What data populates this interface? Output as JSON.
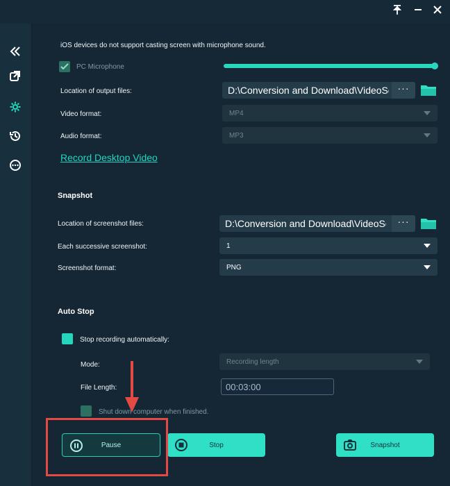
{
  "sidebar": {
    "icons": [
      "collapse-icon",
      "screen-mirror-icon",
      "settings-icon",
      "history-icon",
      "more-icon"
    ]
  },
  "recording": {
    "ios_note": "iOS devices do not support casting screen with microphone sound.",
    "pc_microphone_label": "PC Microphone",
    "pc_microphone_checked": true,
    "microphone_volume_fraction": 1.0,
    "output_location_label": "Location of output files:",
    "output_location_value": "D:\\Conversion and Download\\VideoSo",
    "video_format_label": "Video format:",
    "video_format_value": "MP4",
    "audio_format_label": "Audio format:",
    "audio_format_value": "MP3",
    "record_desktop_link": "Record Desktop Video"
  },
  "snapshot": {
    "title": "Snapshot",
    "location_label": "Location of screenshot files:",
    "location_value": "D:\\Conversion and Download\\VideoSol",
    "successive_label": "Each successive screenshot:",
    "successive_value": "1",
    "format_label": "Screenshot format:",
    "format_value": "PNG"
  },
  "auto_stop": {
    "title": "Auto Stop",
    "stop_auto_label": "Stop recording automatically:",
    "stop_auto_checked": true,
    "mode_label": "Mode:",
    "mode_value": "Recording length",
    "file_length_label": "File Length:",
    "file_length_value": "00:03:00",
    "shutdown_label": "Shut down computer when finished.",
    "shutdown_checked": false
  },
  "controls": {
    "pause_label": "Pause",
    "stop_label": "Stop",
    "snapshot_label": "Snapshot",
    "dots_label": "···"
  },
  "colors": {
    "accent": "#2fe0c6",
    "background": "#152734",
    "annotation": "#e24a43"
  }
}
